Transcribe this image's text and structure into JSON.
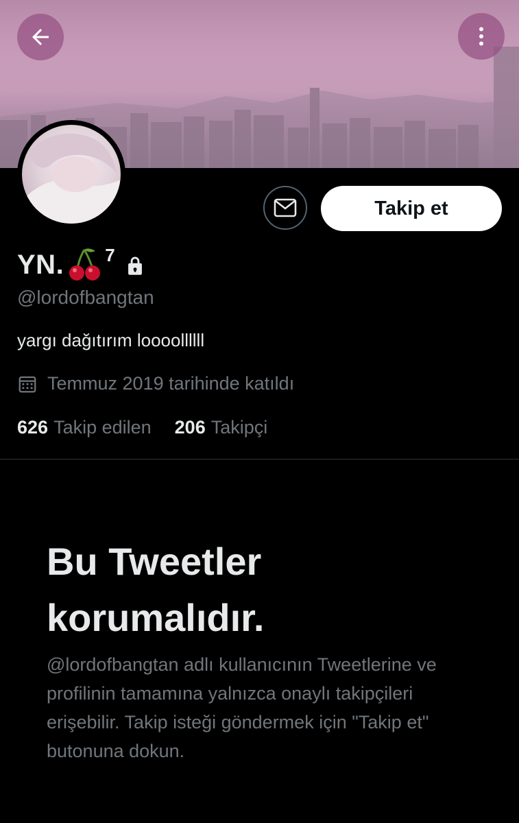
{
  "header": {
    "back_icon": "arrow-left-icon",
    "more_icon": "more-vertical-icon"
  },
  "profile": {
    "display_name": "YN.",
    "name_emoji_icon": "cherry-icon",
    "name_superscript": "7",
    "protected_icon": "lock-icon",
    "handle": "@lordofbangtan",
    "bio": "yargı dağıtırım loooollllll",
    "joined_icon": "calendar-icon",
    "joined_text": "Temmuz 2019 tarihinde katıldı",
    "following_count": "626",
    "following_label": "Takip edilen",
    "followers_count": "206",
    "followers_label": "Takipçi"
  },
  "actions": {
    "message_icon": "envelope-icon",
    "follow_label": "Takip et"
  },
  "protected": {
    "title": "Bu Tweetler korumalıdır.",
    "description": "@lordofbangtan adlı kullanıcının Tweetlerine ve profilinin tamamına yalnızca onaylı takipçileri erişebilir. Takip isteği göndermek için \"Takip et\" butonuna dokun."
  },
  "colors": {
    "background": "#000000",
    "primary_text": "#e7e9ea",
    "secondary_text": "#71767b",
    "follow_button_bg": "#ffffff",
    "header_button_bg": "#965082"
  }
}
